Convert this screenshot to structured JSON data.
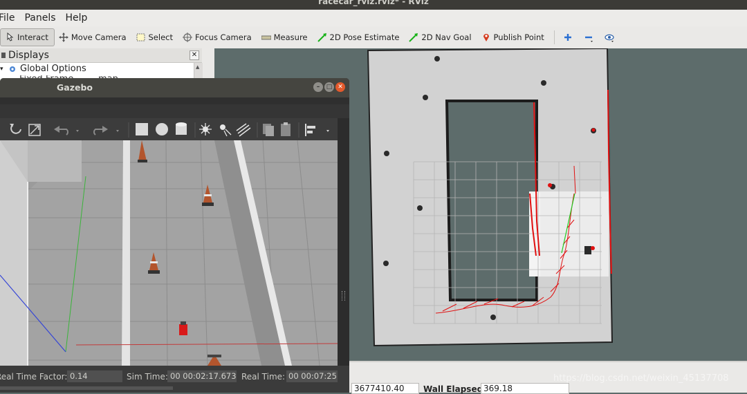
{
  "window": {
    "title": "racecar_rviz.rviz* - RViz"
  },
  "menubar": {
    "items": [
      "File",
      "Panels",
      "Help"
    ]
  },
  "toolbar": {
    "tools": [
      {
        "label": "Interact",
        "icon": "cursor-icon"
      },
      {
        "label": "Move Camera",
        "icon": "move-camera-icon"
      },
      {
        "label": "Select",
        "icon": "select-icon"
      },
      {
        "label": "Focus Camera",
        "icon": "focus-camera-icon"
      },
      {
        "label": "Measure",
        "icon": "measure-icon"
      },
      {
        "label": "2D Pose Estimate",
        "icon": "pose-arrow-icon"
      },
      {
        "label": "2D Nav Goal",
        "icon": "nav-goal-arrow-icon"
      },
      {
        "label": "Publish Point",
        "icon": "map-pin-icon"
      }
    ],
    "extra_icons": [
      "add-icon",
      "remove-icon",
      "eye-icon"
    ]
  },
  "displays": {
    "title": "Displays",
    "close_symbol": "✕",
    "rows": [
      {
        "label": "Global Options"
      },
      {
        "label": "Fixed Frame",
        "value": "map"
      }
    ]
  },
  "rviz_bottom": {
    "ros_elapsed_value": "3677410.40",
    "wall_elapsed_label": "Wall Elapsed:",
    "wall_elapsed_value": "369.18"
  },
  "gazebo": {
    "title": "Gazebo",
    "status": {
      "real_time_factor_label": "Real Time Factor:",
      "real_time_factor_value": "0.14",
      "sim_time_label": "Sim Time:",
      "sim_time_value": "00 00:02:17.673",
      "real_time_label": "Real Time:",
      "real_time_value": "00 00:07:25"
    }
  },
  "watermark": "https://blog.csdn.net/weixin_45137708",
  "colors": {
    "rviz_background": "#5d6c6b",
    "map_free": "#d4d4d4",
    "laser": "#e01010",
    "path": "#22cc22"
  }
}
